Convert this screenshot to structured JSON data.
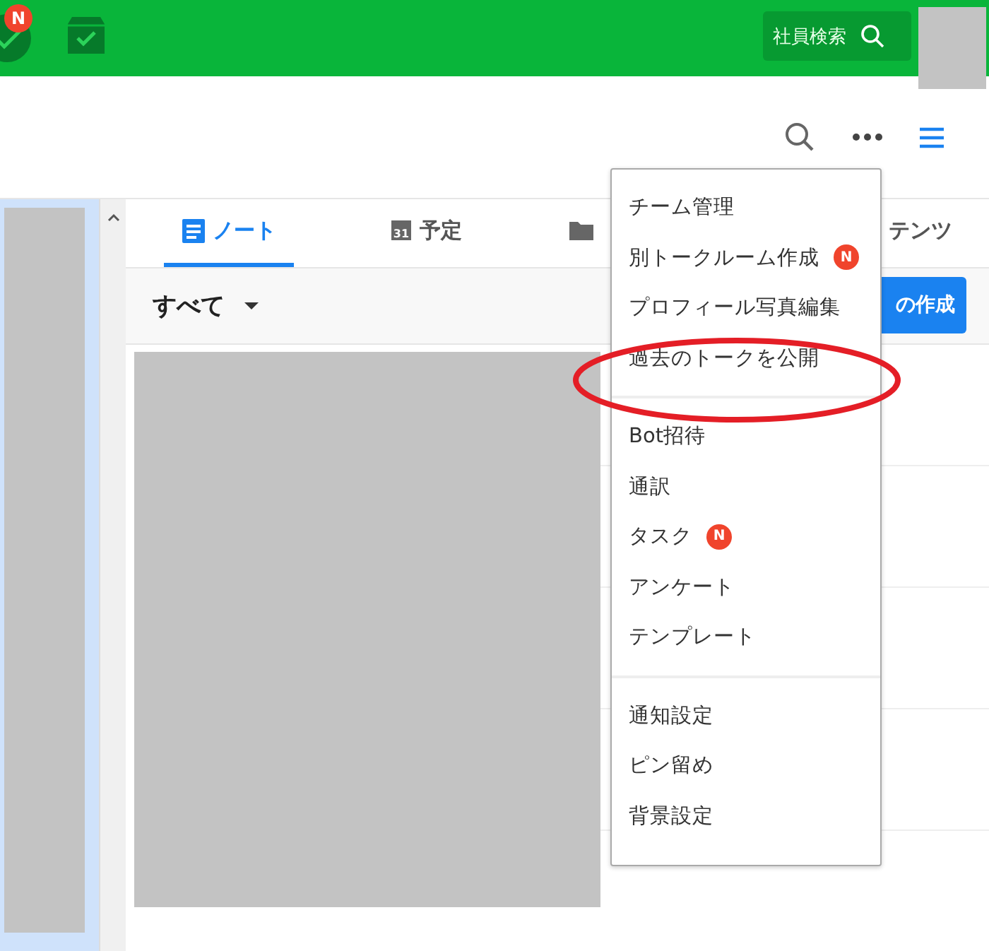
{
  "header": {
    "badge": "N",
    "search_button": "社員検索"
  },
  "tabs": [
    {
      "kind": "note",
      "label": "ノート",
      "selected": true
    },
    {
      "kind": "calendar",
      "label": "予定",
      "icon_text": "31",
      "selected": false
    },
    {
      "kind": "folder",
      "selected": false
    },
    {
      "kind": "plain",
      "label": "テンツ",
      "selected": false
    }
  ],
  "filter": {
    "label": "すべて"
  },
  "create_button": "の作成",
  "menu": {
    "groups": [
      [
        {
          "label": "チーム管理",
          "circled": false
        },
        {
          "label": "別トークルーム作成",
          "badge": "N",
          "circled": false
        },
        {
          "label": "プロフィール写真編集",
          "circled": false
        },
        {
          "label": "過去のトークを公開",
          "circled": true
        }
      ],
      [
        {
          "label": "Bot招待",
          "circled": false
        },
        {
          "label": "通訳",
          "circled": false
        },
        {
          "label": "タスク",
          "badge": "N",
          "circled": false
        },
        {
          "label": "アンケート",
          "circled": false
        },
        {
          "label": "テンプレート",
          "circled": false
        }
      ],
      [
        {
          "label": "通知設定",
          "circled": false
        },
        {
          "label": "ピン留め",
          "circled": false
        },
        {
          "label": "背景設定",
          "circled": false
        }
      ]
    ]
  }
}
